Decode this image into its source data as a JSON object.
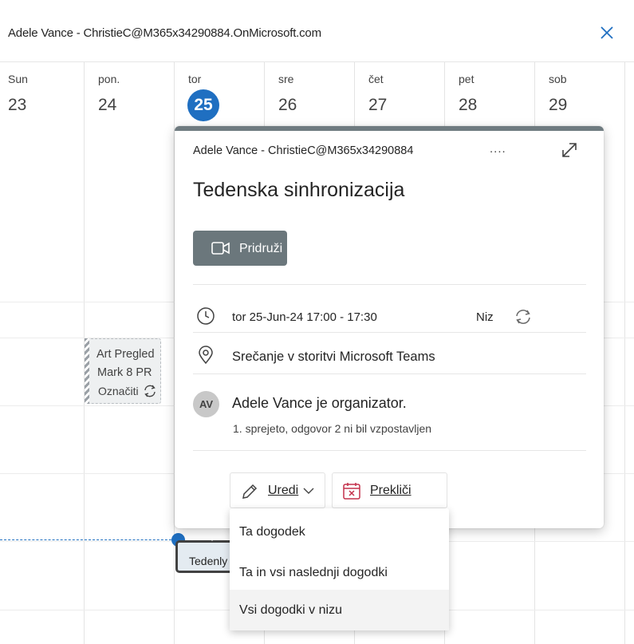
{
  "header": {
    "title": "Adele Vance - ChristieC@M365x34290884.OnMicrosoft.com",
    "close_icon": "close-icon"
  },
  "calendar": {
    "days": [
      {
        "name": "Sun",
        "num": "23"
      },
      {
        "name": "pon.",
        "num": "24"
      },
      {
        "name": "tor",
        "num": "25"
      },
      {
        "name": "sre",
        "num": "26"
      },
      {
        "name": "čet",
        "num": "27"
      },
      {
        "name": "pet",
        "num": "28"
      },
      {
        "name": "sob",
        "num": "29"
      }
    ],
    "today_index": 2,
    "events": {
      "art": {
        "line1": "Art Pregled",
        "line2": "Mark 8 PR",
        "line3": "Označiti"
      },
      "teden": {
        "label": "Tedenly"
      }
    },
    "accent_color": "#1f6fc1"
  },
  "popup": {
    "organizer_account": "Adele Vance - ChristieC@M365x34290884",
    "more_label": "....",
    "title": "Tedenska sinhronizacija",
    "join_label": "Pridruži",
    "datetime": "tor 25-Jun-24 17:00 - 17:30",
    "recurrence_label": "Niz",
    "location": "Srečanje v storitvi Microsoft Teams",
    "avatar_initials": "AV",
    "organizer_text": "Adele Vance je organizator.",
    "responses": "1. sprejeto, odgovor 2 ni bil vzpostavljen",
    "edit_label": "Uredi",
    "cancel_label": "Prekliči",
    "topbar_color": "#6f7b80"
  },
  "dropdown": {
    "items": [
      {
        "label": "Ta dogodek"
      },
      {
        "label": "Ta in vsi naslednji dogodki"
      },
      {
        "label": "Vsi dogodki v nizu"
      }
    ],
    "hovered_index": 2
  }
}
